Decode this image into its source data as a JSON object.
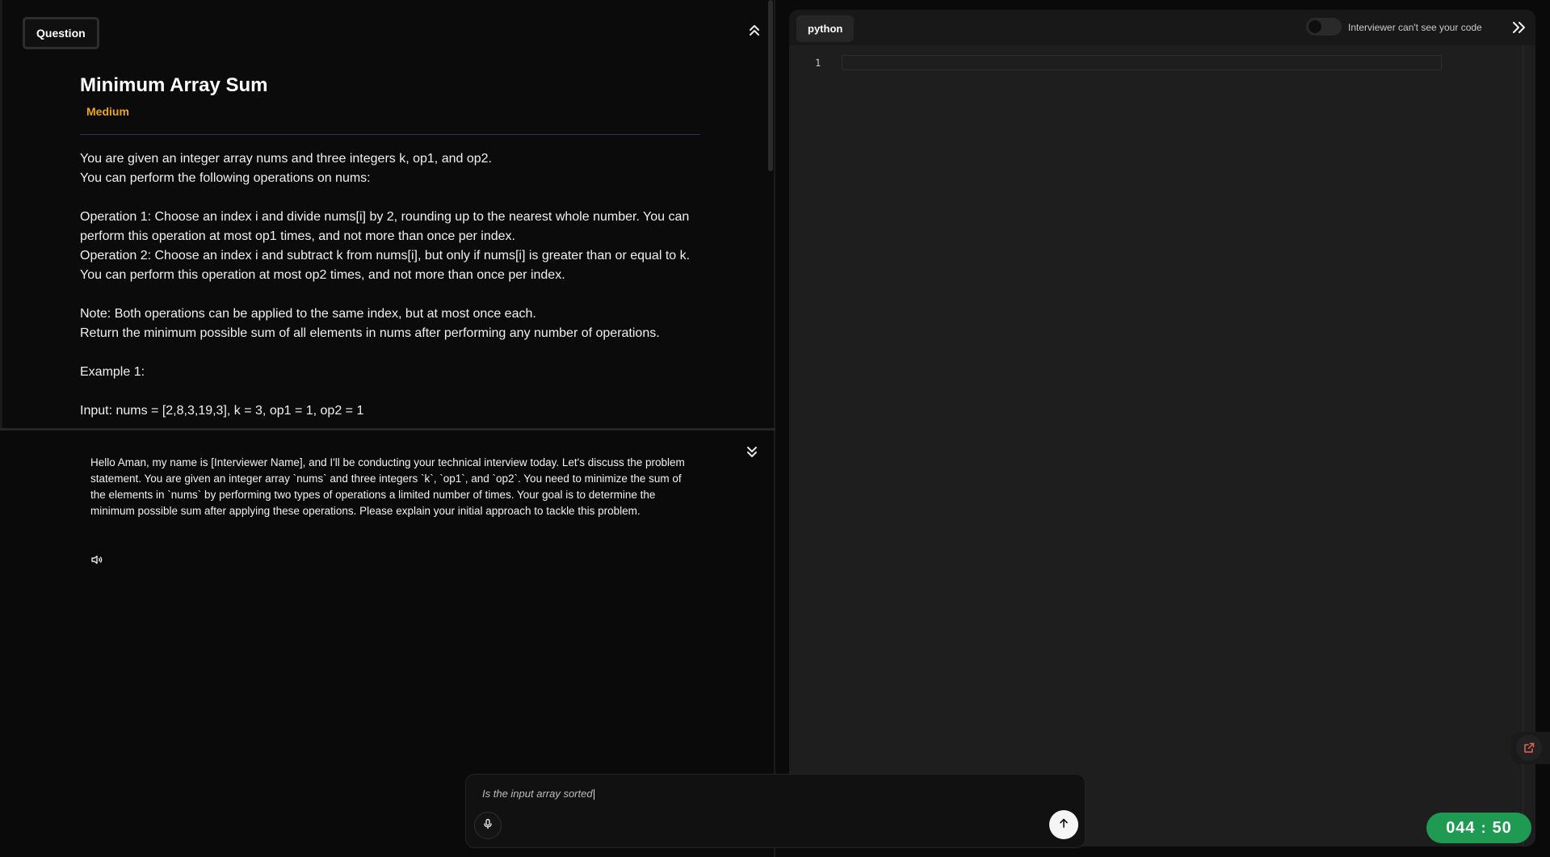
{
  "question": {
    "tab_label": "Question",
    "title": "Minimum Array Sum",
    "difficulty": "Medium",
    "description": "You are given an integer array nums and three integers k, op1, and op2.\nYou can perform the following operations on nums:\n\nOperation 1: Choose an index i and divide nums[i] by 2, rounding up to the nearest whole number. You can perform this operation at most op1 times, and not more than once per index.\nOperation 2: Choose an index i and subtract k from nums[i], but only if nums[i] is greater than or equal to k. You can perform this operation at most op2 times, and not more than once per index.\n\nNote: Both operations can be applied to the same index, but at most once each.\nReturn the minimum possible sum of all elements in nums after performing any number of operations.\n\nExample 1:\n\nInput: nums = [2,8,3,19,3], k = 3, op1 = 1, op2 = 1"
  },
  "chat": {
    "message": "Hello Aman, my name is [Interviewer Name], and I'll be conducting your technical interview today. Let's discuss the problem statement. You are given an integer array `nums` and three integers `k`, `op1`, and `op2`. You need to minimize the sum of the elements in `nums` by performing two types of operations a limited number of times. Your goal is to determine the minimum possible sum after applying these operations. Please explain your initial approach to tackle this problem.",
    "input_value": "Is the input array sorted"
  },
  "editor": {
    "language": "python",
    "visibility_label": "Interviewer can't see your code",
    "line_number": "1"
  },
  "timer": {
    "minutes": "044",
    "seconds": "50"
  },
  "icons": {
    "collapse_up": "chevrons-up-icon",
    "collapse_down": "chevrons-down-icon",
    "speaker": "speaker-icon",
    "mic": "microphone-icon",
    "send": "arrow-up-icon",
    "expand": "chevrons-right-icon",
    "popout": "external-link-icon"
  },
  "colors": {
    "difficulty": "#e8a628",
    "timer_bg": "#1f9a52",
    "popout_icon": "#e0645a"
  }
}
